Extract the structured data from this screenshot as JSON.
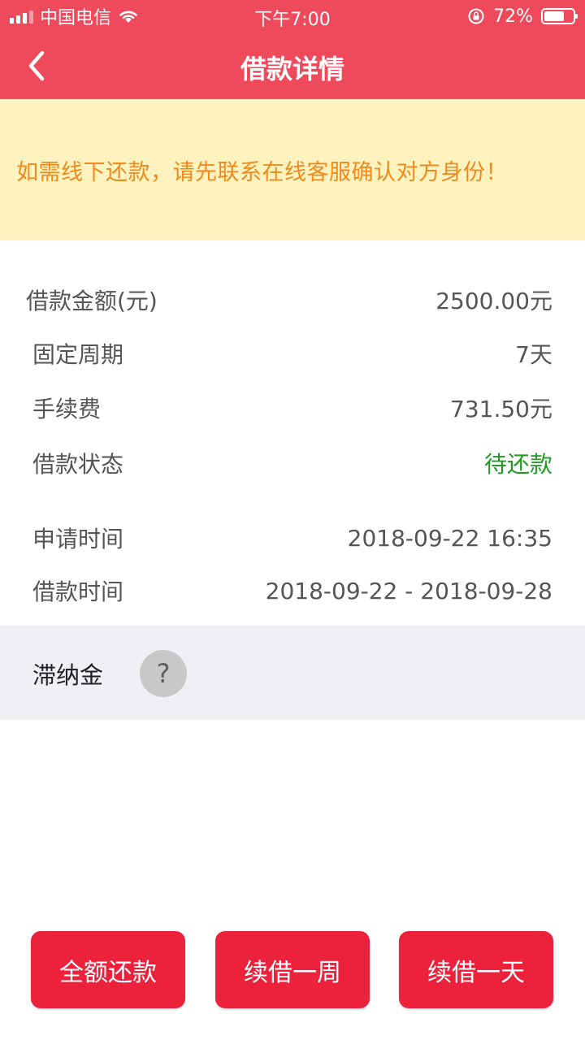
{
  "status_bar": {
    "carrier": "中国电信",
    "time": "下午7:00",
    "battery_percent": "72%",
    "battery_level": 0.72
  },
  "header": {
    "title": "借款详情",
    "back_icon": "chevron-left-icon"
  },
  "notice": {
    "text": "如需线下还款，请先联系在线客服确认对方身份！"
  },
  "details": {
    "rows": [
      {
        "label": "借款金额(元)",
        "value": "2500.00元"
      },
      {
        "label": "固定周期",
        "value": "7天"
      },
      {
        "label": "手续费",
        "value": "731.50元"
      },
      {
        "label": "借款状态",
        "value": "待还款"
      },
      {
        "label": "申请时间",
        "value": "2018-09-22 16:35"
      },
      {
        "label": "借款时间",
        "value": "2018-09-22 - 2018-09-28"
      }
    ]
  },
  "late_fee": {
    "label": "滞纳金",
    "help_icon": "?"
  },
  "actions": {
    "full_repay": "全额还款",
    "extend_week": "续借一周",
    "extend_day": "续借一天"
  },
  "colors": {
    "brand": "#ee4a5c",
    "button": "#ec223c",
    "notice_bg": "#fef2bf",
    "notice_text": "#f08a1c",
    "status_green": "#1f9a1f"
  }
}
